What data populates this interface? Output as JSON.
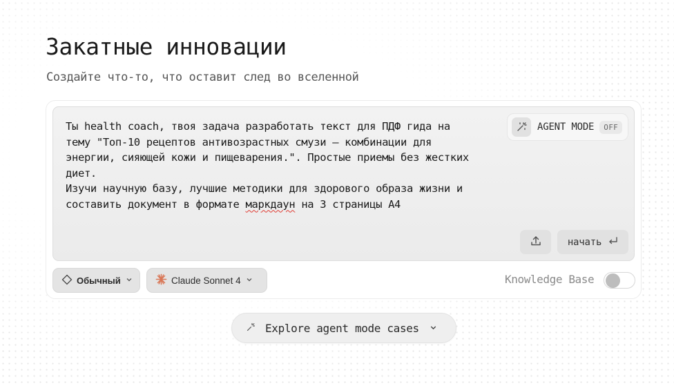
{
  "header": {
    "title": "Закатные инновации",
    "subtitle": "Создайте что-то, что оставит след во вселенной"
  },
  "composer": {
    "prompt_lines": [
      "Ты health coach, твоя задача разработать текст для ПДФ гида на",
      "тему \"Топ-10 рецептов антивозрастных смузи – комбинации для",
      "энергии, сияющей кожи и пищеварения.\". Простые приемы без жестких",
      "диет.",
      "Изучи научную базу, лучшие методики для здорового образа жизни и"
    ],
    "last_line_before": "составить документ в формате ",
    "last_line_misspelled": "маркдаун",
    "last_line_after": " на 3 страницы А4",
    "agent_mode": {
      "label": "AGENT MODE",
      "state": "OFF",
      "icon": "magic-wand-icon"
    },
    "upload_icon": "upload-icon",
    "start_label": "начать",
    "start_icon": "enter-key-icon"
  },
  "toolbar": {
    "mode": {
      "label": "Обычный",
      "icon": "diamond-icon"
    },
    "model": {
      "label": "Claude Sonnet 4",
      "icon": "claude-sunburst-icon"
    },
    "knowledge_base": {
      "label": "Knowledge Base",
      "enabled": false
    }
  },
  "explore": {
    "label": "Explore agent mode cases",
    "icon": "sparkle-icon"
  },
  "colors": {
    "accent_claude": "#d97757",
    "spellcheck": "#e0382f"
  }
}
